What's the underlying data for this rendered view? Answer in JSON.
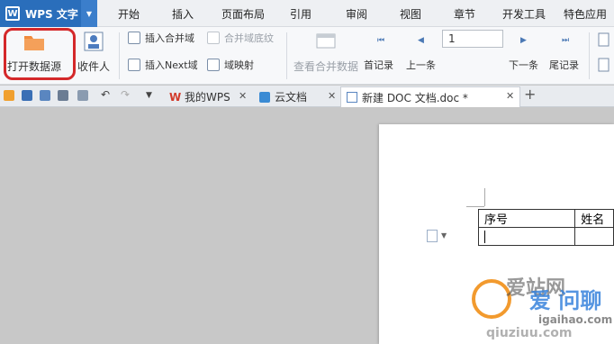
{
  "app": {
    "name": "WPS 文字"
  },
  "menu": [
    "开始",
    "插入",
    "页面布局",
    "引用",
    "审阅",
    "视图",
    "章节",
    "开发工具",
    "特色应用"
  ],
  "ribbon": {
    "open_datasource": "打开数据源",
    "recipients": "收件人",
    "insert_merge_field": "插入合并域",
    "merge_field_shading": "合并域底纹",
    "insert_next_field": "插入Next域",
    "field_mapping": "域映射",
    "view_merged_data": "查看合并数据",
    "first_record": "首记录",
    "prev_record": "上一条",
    "record_number": "1",
    "next_record": "下一条",
    "last_record": "尾记录"
  },
  "tabs": [
    {
      "label": "我的WPS"
    },
    {
      "label": "云文档"
    },
    {
      "label": "新建 DOC 文档.doc *"
    }
  ],
  "document": {
    "table_headers": [
      "序号",
      "姓名"
    ]
  },
  "watermark": {
    "text1": "爱站网",
    "text2": "qiuziuu.com",
    "text3": "爱 问聊",
    "text4": "igaihao.com"
  },
  "colors": {
    "accent": "#2a6ebb",
    "highlight": "#d4282a"
  }
}
